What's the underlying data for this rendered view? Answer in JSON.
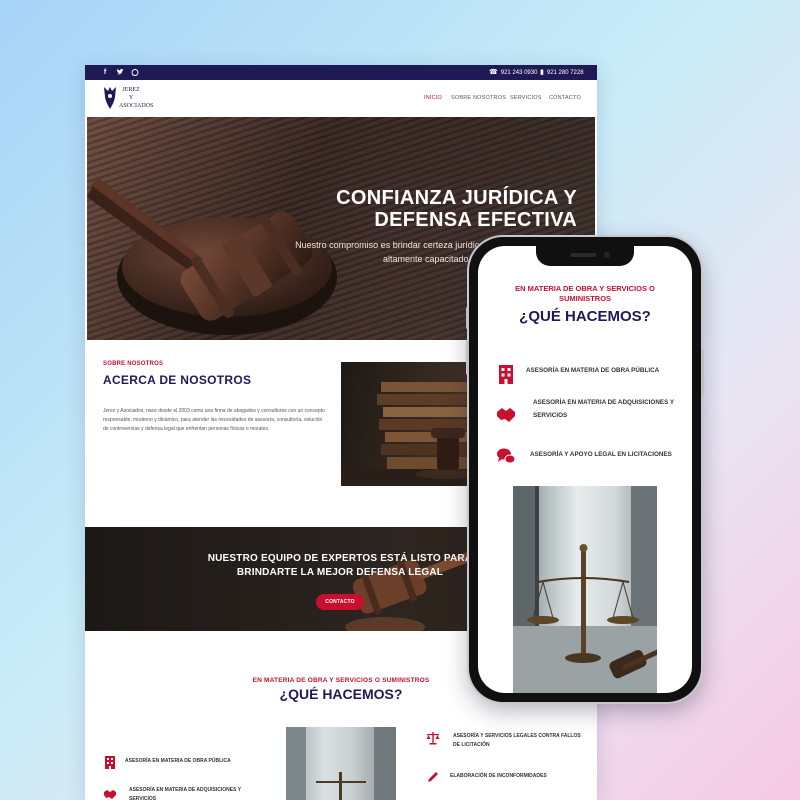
{
  "topbar": {
    "social": [
      "f",
      "t",
      "w"
    ],
    "phone_1": "921 243 0930",
    "phone_2": "921 280 7228",
    "phone_icon": "phone-icon",
    "mobile_icon": "mobile-icon"
  },
  "nav": {
    "logo_text": [
      "JEREZ",
      "Y",
      "ASOCIADOS"
    ],
    "items": [
      "INICIO",
      "SOBRE NOSOTROS",
      "SERVICIOS",
      "CONTACTO"
    ],
    "active_index": 0
  },
  "hero": {
    "title": "CONFIANZA JURÍDICA Y DEFENSA EFECTIVA",
    "subtitle": "Nuestro compromiso es brindar certeza jurídica y defensa a través de un equipo altamente capacitado en cada caso."
  },
  "about": {
    "kicker": "SOBRE NOSOTROS",
    "heading": "ACERCA DE NOSOTROS",
    "paragraph": "Jerez y Asociados, nace desde el 2003 como una firma de abogados y consultores con un concepto responsable, moderno y dinámico, para atender las necesidades de asesoría, consultoría, solución de controversias y defensa legal que enfrentan personas físicas o morales."
  },
  "cta": {
    "text": "NUESTRO EQUIPO DE EXPERTOS ESTÁ LISTO PARA BRINDARTE LA MEJOR DEFENSA LEGAL",
    "button": "CONTACTO"
  },
  "services": {
    "kicker": "EN MATERIA DE OBRA Y SERVICIOS O SUMINISTROS",
    "heading": "¿QUÉ HACEMOS?",
    "left": [
      {
        "label": "ASESORÍA EN MATERIA DE OBRA PÚBLICA",
        "icon": "building-icon"
      },
      {
        "label": "ASESORÍA EN MATERIA DE ADQUISICIONES Y SERVICIOS",
        "icon": "handshake-icon"
      }
    ],
    "right": [
      {
        "label": "ASESORÍA Y SERVICIOS LEGALES CONTRA FALLOS DE LICITACIÓN",
        "icon": "scales-icon"
      },
      {
        "label": "ELABORACIÓN DE INCONFORMIDADES",
        "icon": "pen-icon"
      }
    ]
  },
  "mobile": {
    "kicker": "EN MATERIA DE OBRA Y SERVICIOS O SUMINISTROS",
    "heading": "¿QUÉ HACEMOS?",
    "items": [
      {
        "label": "ASESORÍA EN MATERIA DE OBRA PÚBLICA",
        "icon": "building-icon"
      },
      {
        "label": "ASESORÍA EN MATERIA DE ADQUISICIONES Y SERVICIOS",
        "icon": "handshake-icon"
      },
      {
        "label": "ASESORÍA Y APOYO LEGAL EN LICITACIONES",
        "icon": "chat-bubbles-icon"
      }
    ]
  },
  "colors": {
    "brand_navy": "#1f1a55",
    "accent_red": "#c8102e"
  }
}
